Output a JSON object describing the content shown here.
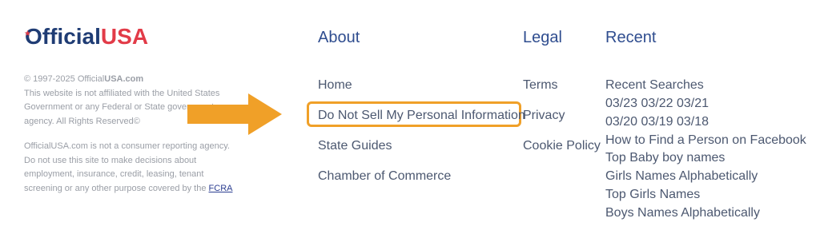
{
  "logo": {
    "part1": "fficial",
    "part2": "USA",
    "first_letter": "O"
  },
  "legal": {
    "copyright_prefix": "© 1997-2025 Official",
    "copyright_bold": "USA.com",
    "disclaimer1": "This website is not affiliated with the United States Government or any Federal or State government agency. All Rights Reserved©",
    "disclaimer2": "OfficialUSA.com is not a consumer reporting agency. Do not use this site to make decisions about employment, insurance, credit, leasing, tenant screening or any other purpose covered by the ",
    "fcra_link": "FCRA"
  },
  "about": {
    "heading": "About",
    "links": [
      "Home",
      "Do Not Sell My Personal Information",
      "State Guides",
      "Chamber of Commerce"
    ]
  },
  "legal_menu": {
    "heading": "Legal",
    "links": [
      "Terms",
      "Privacy",
      "Cookie Policy"
    ]
  },
  "recent": {
    "heading": "Recent",
    "links": [
      "Recent Searches",
      "03/23 03/22 03/21",
      "03/20 03/19 03/18",
      "How to Find a Person on Facebook",
      "Top Baby boy names",
      "Girls Names Alphabetically",
      "Top Girls Names",
      "Boys Names Alphabetically"
    ]
  },
  "colors": {
    "brand_blue": "#1f3c74",
    "brand_red": "#e23b48",
    "highlight": "#f0a028"
  }
}
